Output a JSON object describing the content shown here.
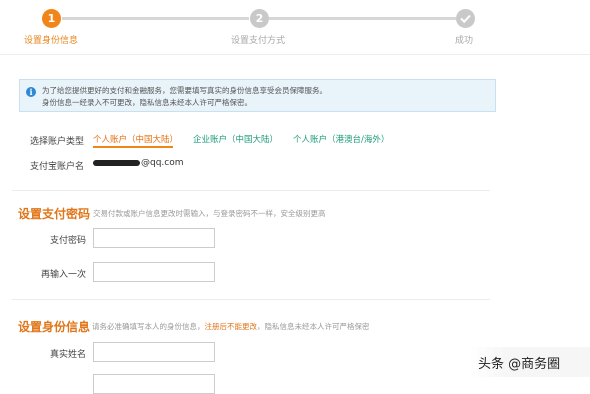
{
  "stepper": {
    "steps": [
      {
        "number": "1",
        "label": "设置身份信息",
        "state": "active"
      },
      {
        "number": "2",
        "label": "设置支付方式",
        "state": "inactive"
      },
      {
        "number": "",
        "label": "成功",
        "state": "inactive"
      }
    ]
  },
  "notice": {
    "line1": "为了给您提供更好的支付和金融服务，您需要填写真实的身份信息享受会员保障服务。",
    "line2": "身份信息一经录入不可更改，隐私信息未经本人许可严格保密。"
  },
  "account": {
    "type_label": "选择账户类型",
    "tabs": [
      "个人账户（中国大陆）",
      "企业账户（中国大陆）",
      "个人账户（港澳台/海外）"
    ],
    "selected_index": 0,
    "name_label": "支付宝账户名",
    "name_value_suffix": "@qq.com"
  },
  "payment_password": {
    "title": "设置支付密码",
    "hint": "交易付款或账户信息更改时需输入，与登录密码不一样，安全级别更高",
    "password_label": "支付密码",
    "confirm_label": "再输入一次"
  },
  "identity": {
    "title": "设置身份信息",
    "hint_before": "请务必准确填写本人的身份信息，",
    "hint_highlight": "注册后不能更改",
    "hint_after": "，隐私信息未经本人许可严格保密",
    "real_name_label": "真实姓名"
  },
  "watermark": {
    "text": "头条 @商务圈"
  },
  "colors": {
    "accent": "#f08519",
    "link": "#1d9b7a",
    "info": "#2e88d3"
  }
}
